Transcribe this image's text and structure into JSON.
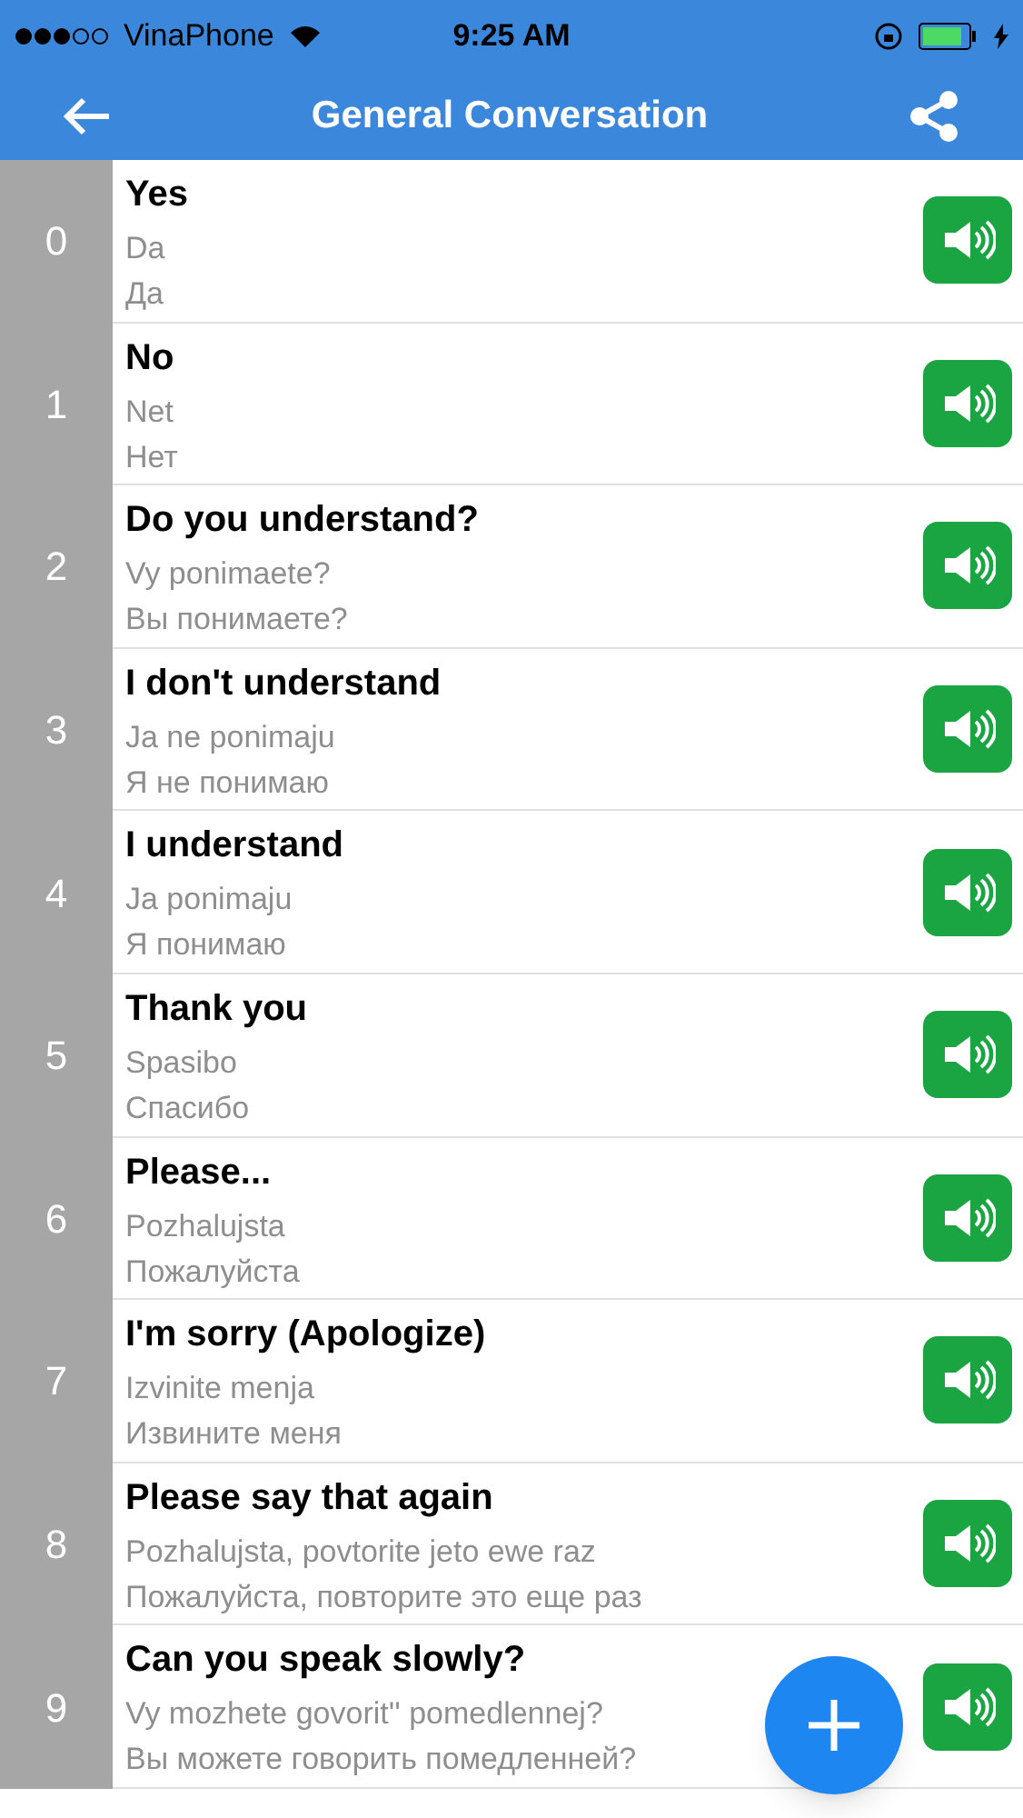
{
  "status_bar": {
    "carrier": "VinaPhone",
    "time": "9:25 AM"
  },
  "nav": {
    "title": "General Conversation"
  },
  "phrases": [
    {
      "index": "0",
      "english": "Yes",
      "transliteration": "Da",
      "russian": "Да"
    },
    {
      "index": "1",
      "english": "No",
      "transliteration": "Net",
      "russian": "Нет"
    },
    {
      "index": "2",
      "english": "Do you understand?",
      "transliteration": "Vy ponimaete?",
      "russian": "Вы понимаете?"
    },
    {
      "index": "3",
      "english": "I don't understand",
      "transliteration": "Ja ne ponimaju",
      "russian": "Я не понимаю"
    },
    {
      "index": "4",
      "english": "I understand",
      "transliteration": "Ja ponimaju",
      "russian": "Я понимаю"
    },
    {
      "index": "5",
      "english": "Thank you",
      "transliteration": "Spasibo",
      "russian": "Спасибо"
    },
    {
      "index": "6",
      "english": "Please...",
      "transliteration": "Pozhalujsta",
      "russian": "Пожалуйста"
    },
    {
      "index": "7",
      "english": "I'm sorry (Apologize)",
      "transliteration": "Izvinite menja",
      "russian": "Извините меня"
    },
    {
      "index": "8",
      "english": "Please say that again",
      "transliteration": "Pozhalujsta, povtorite jeto ewe raz",
      "russian": "Пожалуйста, повторите это еще раз"
    },
    {
      "index": "9",
      "english": "Can you speak slowly?",
      "transliteration": "Vy mozhete govorit'' pomedlennej?",
      "russian": "Вы можете говорить помедленней?"
    }
  ]
}
